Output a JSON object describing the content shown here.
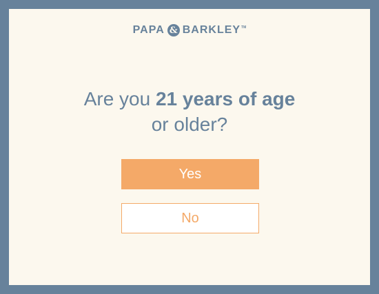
{
  "brand": {
    "name_left": "PAPA",
    "ampersand": "&",
    "name_right": "BARKLEY",
    "trademark": "TM"
  },
  "question": {
    "prefix": "Are you ",
    "emphasis": "21 years of age",
    "line2": "or older?"
  },
  "buttons": {
    "yes_label": "Yes",
    "no_label": "No"
  },
  "colors": {
    "frame": "#67829b",
    "background": "#fcf8ee",
    "accent": "#f4a968"
  }
}
